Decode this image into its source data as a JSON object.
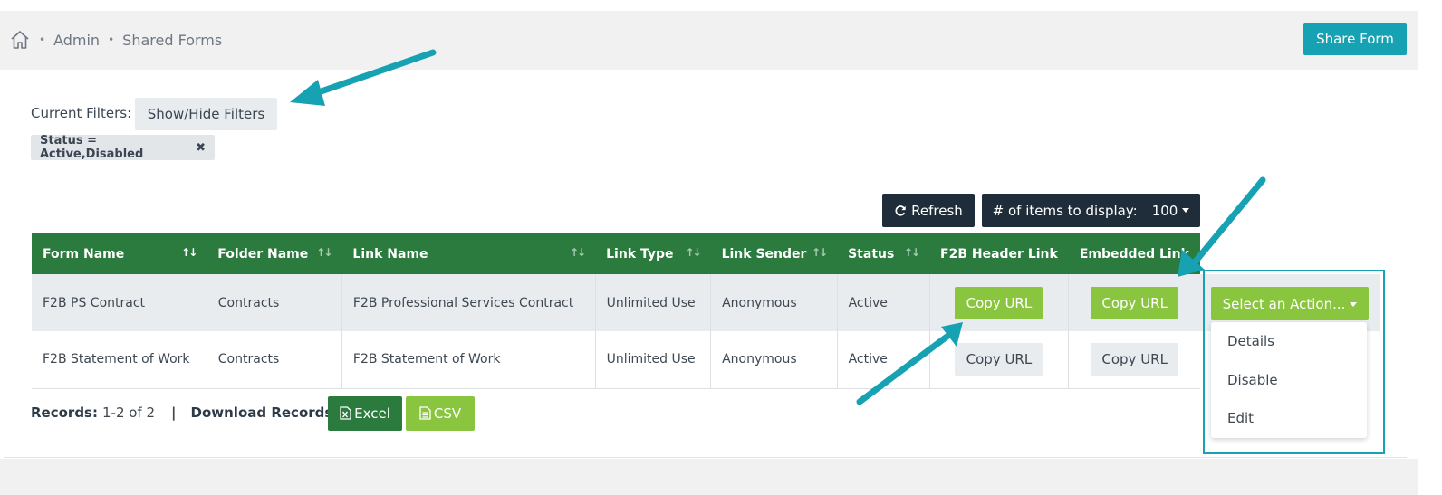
{
  "breadcrumb": {
    "home_icon": "home-icon",
    "items": [
      "Admin",
      "Shared Forms"
    ]
  },
  "header": {
    "share_button": "Share Form",
    "accent": "#16a2b3"
  },
  "filters": {
    "label": "Current Filters:",
    "toggle_button": "Show/Hide Filters",
    "active_filter": "Status = Active,Disabled",
    "remove_icon": "close-icon"
  },
  "toolbar": {
    "refresh_icon": "refresh-icon",
    "refresh_label": "Refresh",
    "items_label": "# of items to display:",
    "items_value": "100"
  },
  "table": {
    "header_color": "#2b7a3e",
    "columns": [
      "Form Name",
      "Folder Name",
      "Link Name",
      "Link Type",
      "Link Sender",
      "Status",
      "F2B Header Link",
      "Embedded Link"
    ],
    "rows": [
      {
        "form_name": "F2B PS Contract",
        "folder_name": "Contracts",
        "link_name": "F2B Professional Services Contract",
        "link_type": "Unlimited Use",
        "link_sender": "Anonymous",
        "status": "Active",
        "header_link_btn": "Copy URL",
        "embedded_link_btn": "Copy URL",
        "action_btn": "Select an Action..."
      },
      {
        "form_name": "F2B Statement of Work",
        "folder_name": "Contracts",
        "link_name": "F2B Statement of Work",
        "link_type": "Unlimited Use",
        "link_sender": "Anonymous",
        "status": "Active",
        "header_link_btn": "Copy URL",
        "embedded_link_btn": "Copy URL"
      }
    ]
  },
  "action_menu": {
    "items": [
      "Details",
      "Disable",
      "Edit"
    ]
  },
  "footer": {
    "records_label": "Records:",
    "records_value": "1-2 of 2",
    "separator": "|",
    "download_label": "Download Records",
    "excel_icon": "excel-file-icon",
    "excel_label": "Excel",
    "csv_icon": "csv-file-icon",
    "csv_label": "CSV"
  },
  "annotation_color": "#16a2b3"
}
